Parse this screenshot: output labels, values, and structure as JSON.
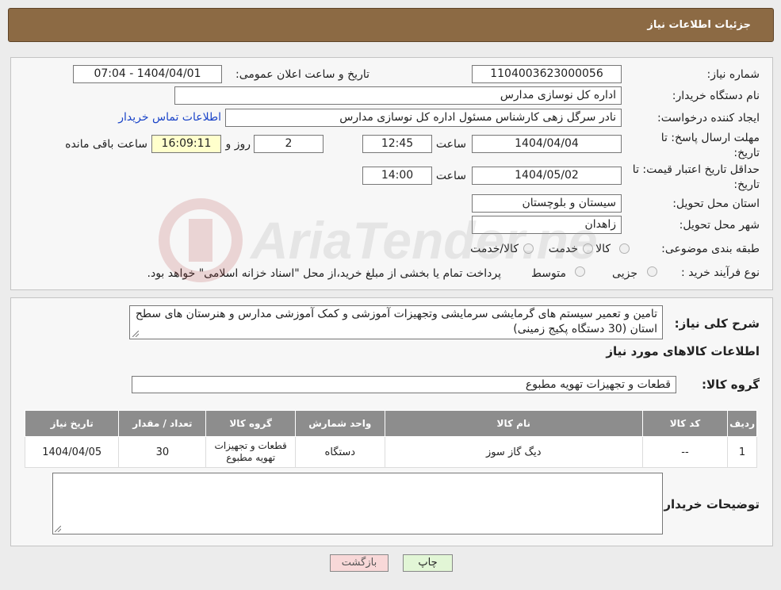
{
  "header": {
    "title": "جزئیات اطلاعات نیاز"
  },
  "need_info": {
    "need_number_label": "شماره نیاز:",
    "need_number": "1104003623000056",
    "announce_label": "تاریخ و ساعت اعلان عمومی:",
    "announce_value": "1404/04/01 - 07:04",
    "buyer_org_label": "نام دستگاه خریدار:",
    "buyer_org": "اداره کل نوسازی مدارس",
    "requester_label": "ایجاد کننده درخواست:",
    "requester": "نادر سرگل زهی کارشناس مسئول اداره کل نوسازی مدارس",
    "contact_link": "اطلاعات تماس خریدار",
    "deadline_label_1": "مهلت ارسال پاسخ: تا",
    "deadline_label_2": "تاریخ:",
    "deadline_date": "1404/04/04",
    "time_label": "ساعت",
    "deadline_time": "12:45",
    "days_value": "2",
    "days_label": "روز و",
    "remaining_time": "16:09:11",
    "remaining_label": "ساعت باقی مانده",
    "validity_label_1": "حداقل تاریخ اعتبار قیمت: تا",
    "validity_label_2": "تاریخ:",
    "validity_date": "1404/05/02",
    "validity_time_label": "ساعت",
    "validity_time": "14:00",
    "province_label": "استان محل تحویل:",
    "province": "سیستان و بلوچستان",
    "city_label": "شهر محل تحویل:",
    "city": "زاهدان",
    "category_label": "طبقه بندی موضوعی:",
    "category_options": [
      "کالا",
      "خدمت",
      "کالا/خدمت"
    ],
    "process_label": "نوع فرآیند خرید :",
    "process_options": [
      "جزیی",
      "متوسط"
    ],
    "process_note": "پرداخت تمام یا بخشی از مبلغ خرید،از محل \"اسناد خزانه اسلامی\" خواهد بود."
  },
  "description": {
    "label": "شرح کلی نیاز:",
    "text": "تامین و تعمیر سیستم های گرمایشی سرمایشی وتجهیزات آموزشی و کمک آموزشی مدارس و هنرستان های سطح استان (30 دستگاه پکیج زمینی)"
  },
  "goods": {
    "section_title": "اطلاعات کالاهای مورد نیاز",
    "group_label": "گروه کالا:",
    "group_value": "قطعات و تجهیزات تهویه مطبوع",
    "columns": [
      "ردیف",
      "کد کالا",
      "نام کالا",
      "واحد شمارش",
      "گروه کالا",
      "تعداد / مقدار",
      "تاریخ نیاز"
    ],
    "rows": [
      {
        "index": "1",
        "code": "--",
        "name": "دیگ گاز سوز",
        "unit": "دستگاه",
        "group": "قطعات و تجهیزات تهویه مطبوع",
        "qty": "30",
        "date": "1404/04/05"
      }
    ]
  },
  "buyer_notes": {
    "label": "توضیحات خریدار:",
    "value": ""
  },
  "buttons": {
    "print": "چاپ",
    "back": "بازگشت"
  },
  "watermark": {
    "text": "AriaTender.neT"
  },
  "colors": {
    "header_bg": "#8c6a44",
    "table_header_bg": "#8d8d8d",
    "link": "#1a44c8",
    "back_button_bg": "#f8d8d8",
    "print_button_bg": "#e2f6d6"
  }
}
